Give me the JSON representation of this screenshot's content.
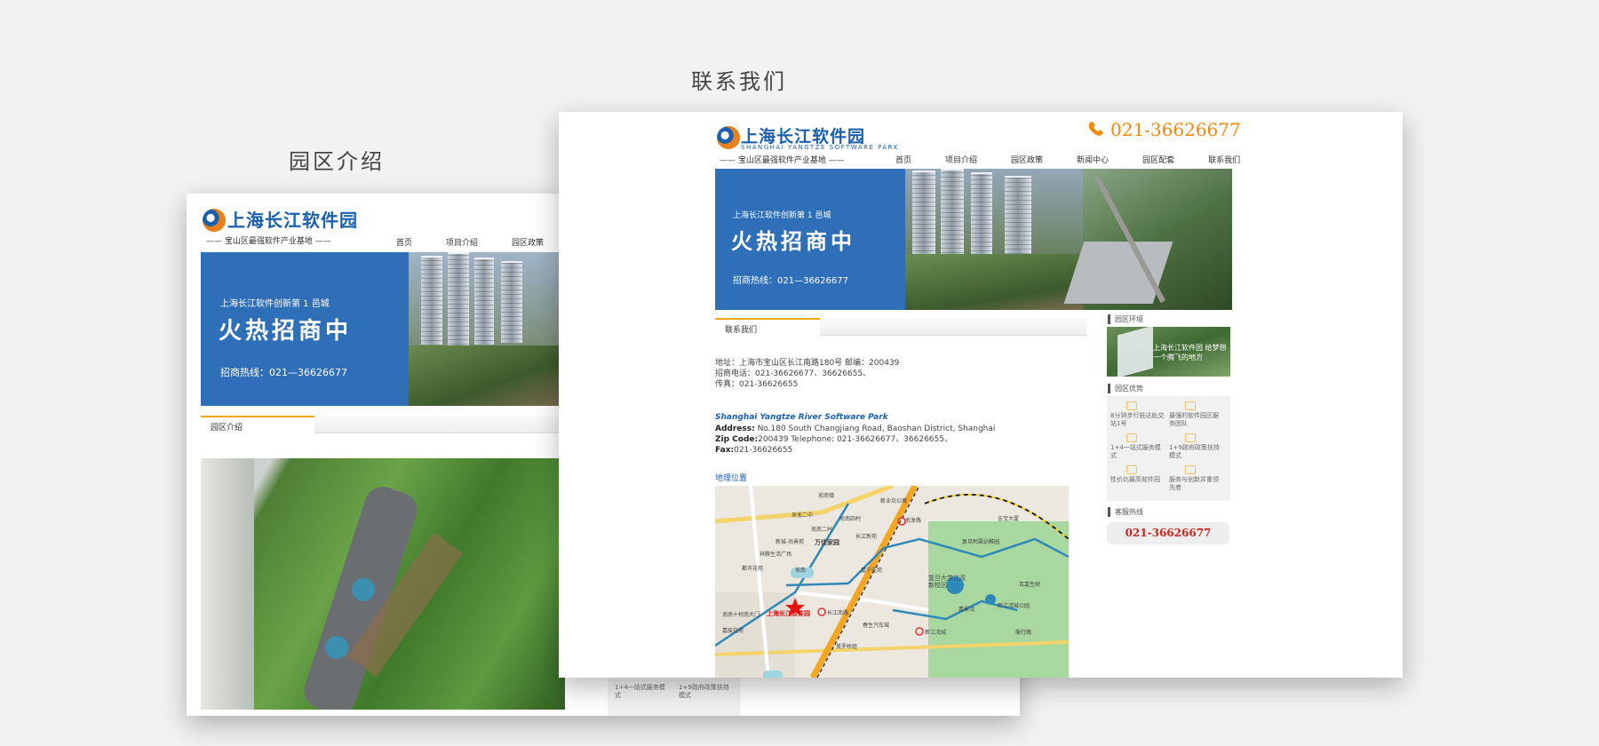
{
  "captions": {
    "park_intro": "园区介绍",
    "contact_us": "联系我们"
  },
  "site": {
    "logo_cn": "上海长江软件园",
    "logo_en": "SHANGHAI YANGTZE SOFTWARE PARK",
    "tagline": "—— 宝山区最强软件产业基地 ——",
    "phone": "021-36626677",
    "nav": [
      "首页",
      "项目介绍",
      "园区政策",
      "新闻中心",
      "园区配套",
      "联系我们"
    ]
  },
  "banner": {
    "pre": "上海长江软件创新第 1 邑城",
    "big": "火热招商中",
    "hotline": "招商热线：021—36626677"
  },
  "park_intro_page": {
    "tab": "园区介绍",
    "adv_items": [
      "1+4一站式服务模式",
      "1+9政府政策扶持模式"
    ]
  },
  "contact_page": {
    "tab": "联系我们",
    "cn": {
      "address": "地址：上海市宝山区长江南路180号 邮编：200439",
      "phone": "招商电话：021-36626677、36626655、",
      "fax": "传真：021-36626655"
    },
    "en": {
      "title": "Shanghai Yangtze River Software Park",
      "address_label": "Address:",
      "address": " No.180 South Changjiang Road, Baoshan District, Shanghai",
      "zip_label": "Zip Code:",
      "zip": "200439 Telephone: 021-36626677、36626655、",
      "fax_label": "Fax:",
      "fax": "021-36626655"
    },
    "map_title": "地理位置",
    "map_labels": [
      "淞南镇",
      "新业坊公寓",
      "吴淞二中",
      "淞南四村",
      "淞发路",
      "淞南二村",
      "长江新苑",
      "新城-尚景苑",
      "万佳家园",
      "吉宝大厦",
      "祥腾生活广场",
      "淞南",
      "都市花苑",
      "复旦附属幼稚园",
      "复旦大学江湾新校区",
      "百嘉生财",
      "嘉宁花苑",
      "嘉景湾",
      "新江湾城公园",
      "淞南十村南大门",
      "上海长江软件园",
      "长江南路",
      "嘉骏花苑",
      "春生汽车城",
      "新江湾城",
      "殷行路",
      "美罗桥庭",
      "淞南"
    ],
    "sidebar": {
      "env": "园区环境",
      "env_caption": "上海长江软件园 给梦想一个腾飞的地方",
      "adv": "园区优势",
      "adv_items": [
        "8分钟步行抵达轨交站1号",
        "最强的软件园区服务团队",
        "1+4一站式服务模式",
        "1+9政府政策扶持模式",
        "性价比最高软件园",
        "服务与创新并重领先者"
      ],
      "hotline_title": "客服热线",
      "hotline": "021-36626677"
    }
  },
  "colors": {
    "brand_blue": "#1a5fae",
    "banner_blue": "#2f6fb7",
    "accent_orange": "#f0a818",
    "hotline_red": "#c7261c",
    "phone_orange": "#f08a0c"
  }
}
